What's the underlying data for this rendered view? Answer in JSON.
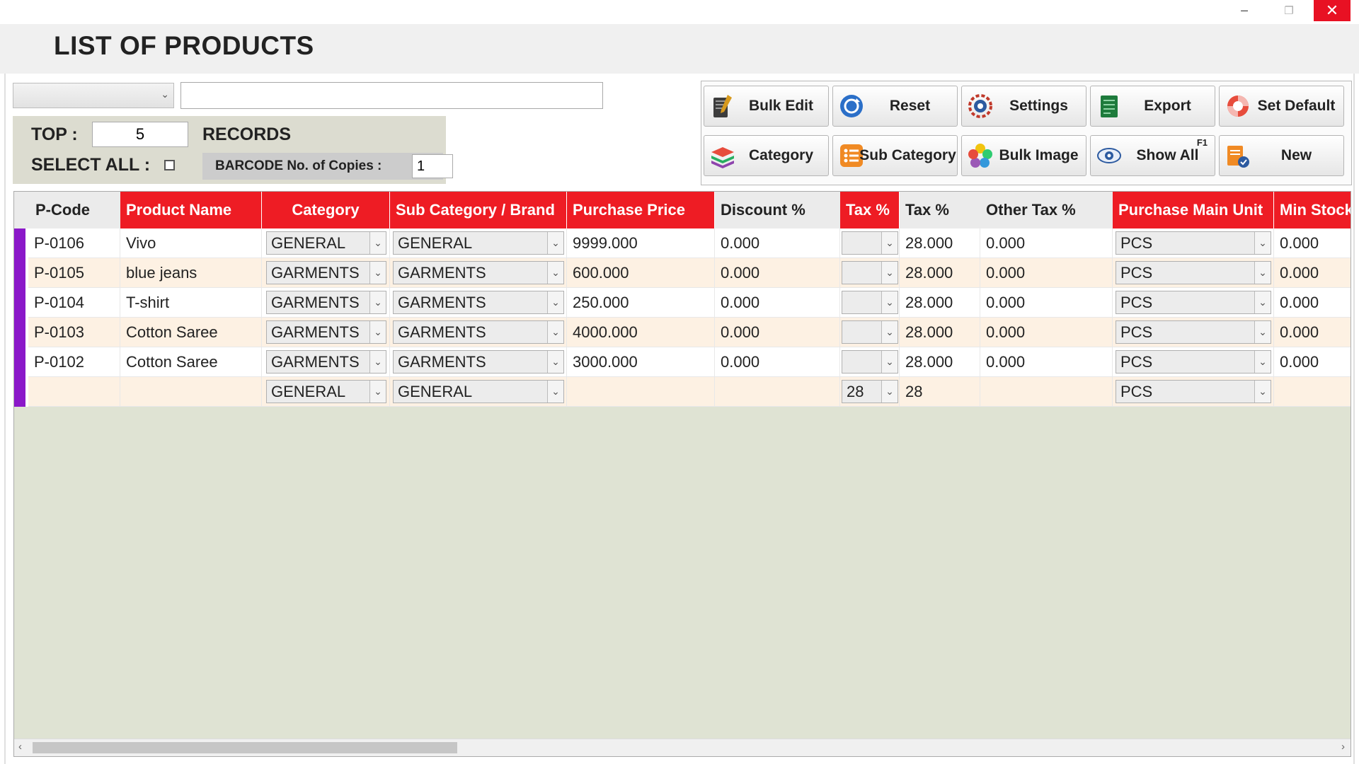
{
  "window": {
    "minimize": "─",
    "maximize": "❐",
    "close": "✕"
  },
  "header": {
    "title": "LIST OF PRODUCTS"
  },
  "filter": {
    "selected": "",
    "search_value": ""
  },
  "top_panel": {
    "top_label": "TOP :",
    "top_value": "5",
    "records_label": "RECORDS",
    "select_all_label": "SELECT ALL :",
    "barcode_label": "BARCODE No. of Copies :",
    "barcode_value": "1"
  },
  "toolbar": {
    "bulk_edit": "Bulk Edit",
    "reset": "Reset",
    "settings": "Settings",
    "export": "Export",
    "set_default": "Set Default",
    "category": "Category",
    "sub_category": "Sub Category",
    "bulk_image": "Bulk Image",
    "show_all": "Show All",
    "show_all_shortcut": "F1",
    "new": "New"
  },
  "table": {
    "columns": [
      "P-Code",
      "Product Name",
      "Category",
      "Sub Category / Brand",
      "Purchase Price",
      "Discount %",
      "Tax %",
      "Tax %",
      "Other Tax %",
      "Purchase Main Unit",
      "Min Stock"
    ],
    "rows": [
      [
        "P-0106",
        "Vivo",
        "GENERAL",
        "GENERAL",
        "9999.000",
        "0.000",
        "",
        "28.000",
        "0.000",
        "PCS",
        "0.000"
      ],
      [
        "P-0105",
        "blue jeans",
        "GARMENTS",
        "GARMENTS",
        "600.000",
        "0.000",
        "",
        "28.000",
        "0.000",
        "PCS",
        "0.000"
      ],
      [
        "P-0104",
        "T-shirt",
        "GARMENTS",
        "GARMENTS",
        "250.000",
        "0.000",
        "",
        "28.000",
        "0.000",
        "PCS",
        "0.000"
      ],
      [
        "P-0103",
        "Cotton Saree",
        "GARMENTS",
        "GARMENTS",
        "4000.000",
        "0.000",
        "",
        "28.000",
        "0.000",
        "PCS",
        "0.000"
      ],
      [
        "P-0102",
        "Cotton Saree",
        "GARMENTS",
        "GARMENTS",
        "3000.000",
        "0.000",
        "",
        "28.000",
        "0.000",
        "PCS",
        "0.000"
      ],
      [
        "",
        "",
        "GENERAL",
        "GENERAL",
        "",
        "",
        "28",
        "28",
        "",
        "PCS",
        ""
      ]
    ]
  },
  "colors": {
    "header_red": "#ee1c24",
    "row_indicator": "#8b18c9",
    "grid_bg": "#dfe3d3"
  }
}
